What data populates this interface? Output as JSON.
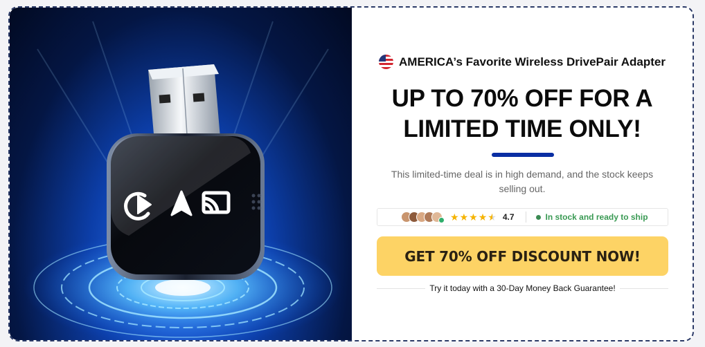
{
  "hero": {
    "image_alt": "Wireless DrivePair adapter",
    "icons": [
      "play-circle-icon",
      "navigation-arrow-icon",
      "cast-icon"
    ]
  },
  "content": {
    "brand_line": "AMERICA’s Favorite Wireless DrivePair Adapter",
    "flag_icon": "us-flag-icon",
    "headline_1": "UP TO 70% OFF FOR A",
    "headline_2": "LIMITED TIME ONLY!",
    "subtext": "This limited-time deal is in high demand, and the stock keeps selling out.",
    "rating": {
      "value": "4.7",
      "stars": 4.5
    },
    "stock_text": "In stock and ready to ship",
    "cta_label": "GET 70% OFF DISCOUNT NOW!",
    "guarantee": "Try it today with a 30-Day Money Back Guarantee!"
  },
  "colors": {
    "accent": "#0a2ea3",
    "cta": "#fdd365",
    "stock": "#3a9a54",
    "stars": "#f5b300"
  }
}
